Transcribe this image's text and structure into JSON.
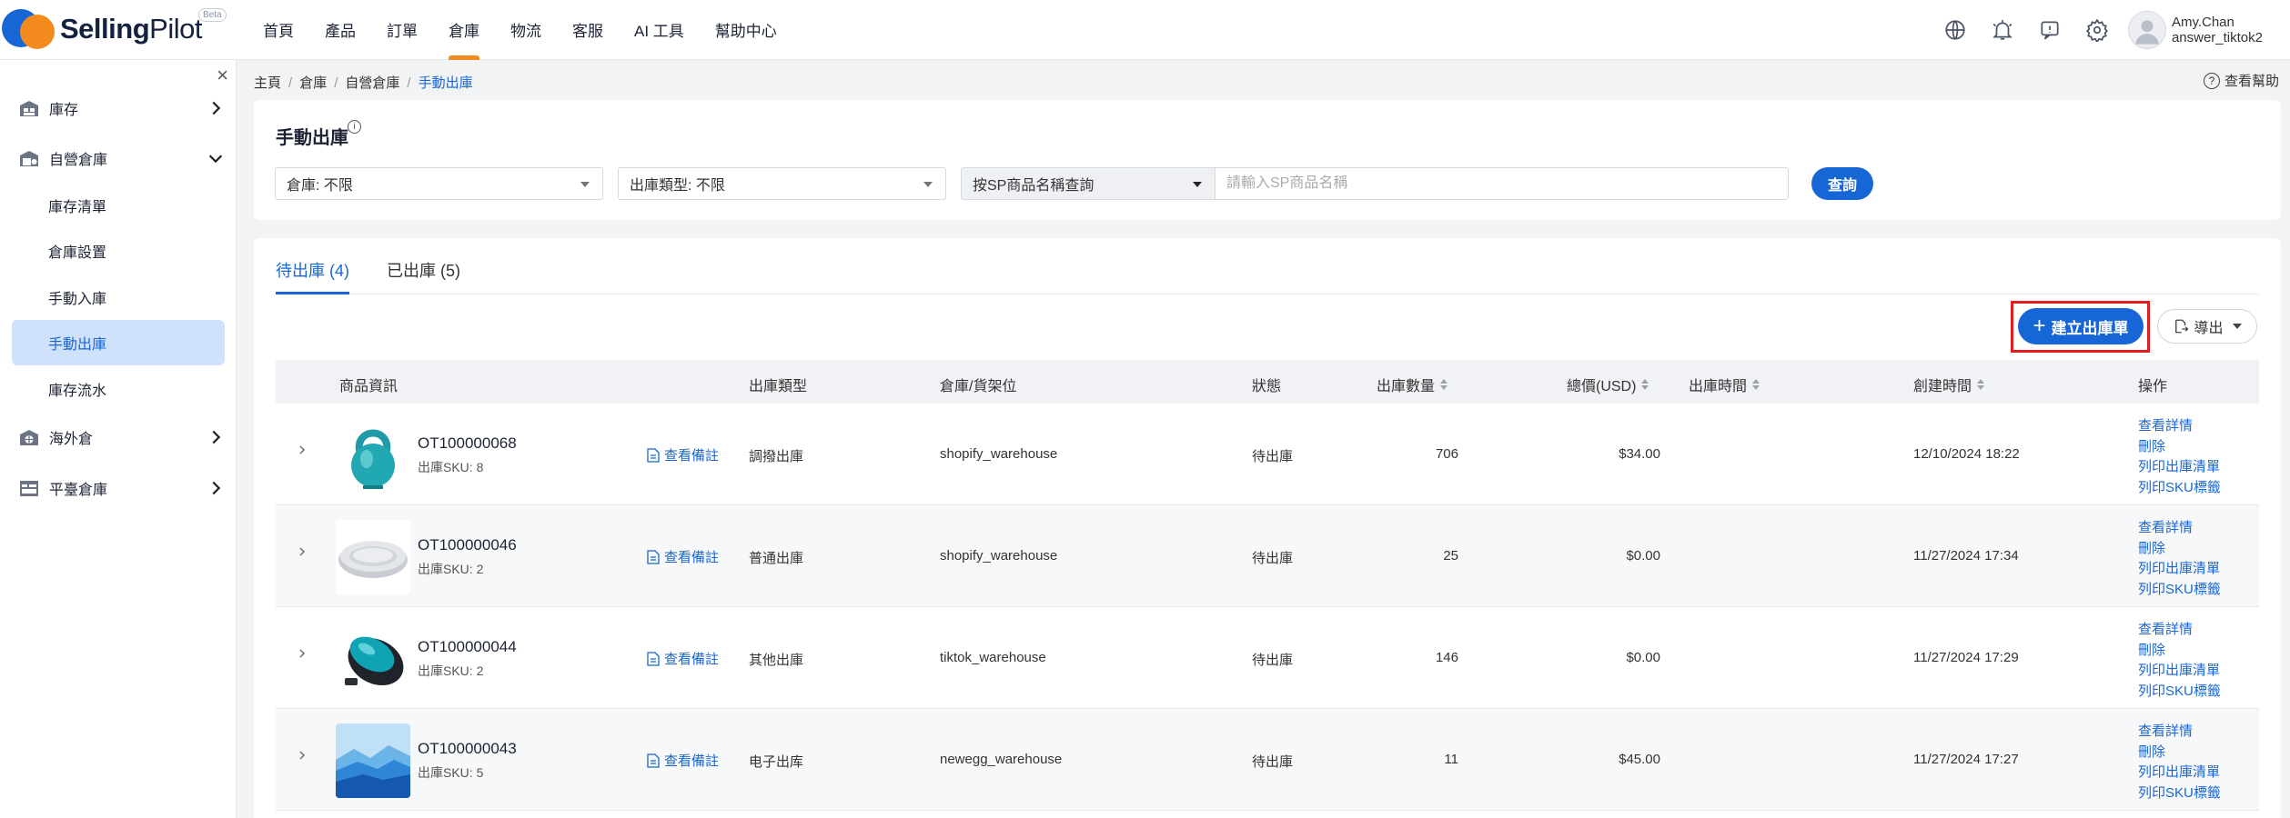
{
  "brand": {
    "name_bold": "Selling",
    "name_light": "Pilot",
    "badge": "Beta"
  },
  "nav": [
    "首頁",
    "產品",
    "訂單",
    "倉庫",
    "物流",
    "客服",
    "AI 工具",
    "幫助中心"
  ],
  "nav_active": 3,
  "user": {
    "name": "Amy.Chan",
    "account": "answer_tiktok2"
  },
  "sidebar": {
    "groups": [
      {
        "label": "庫存",
        "icon": "warehouse-icon"
      },
      {
        "label": "自營倉庫",
        "icon": "own-warehouse-icon"
      },
      {
        "label": "海外倉",
        "icon": "overseas-warehouse-icon"
      },
      {
        "label": "平臺倉庫",
        "icon": "platform-warehouse-icon"
      }
    ],
    "subitems": [
      "庫存清單",
      "倉庫設置",
      "手動入庫",
      "手動出庫",
      "庫存流水"
    ],
    "active_sub": 3
  },
  "breadcrumb": [
    "主頁",
    "倉庫",
    "自營倉庫",
    "手動出庫"
  ],
  "help": "查看幫助",
  "page_title": "手動出庫",
  "filters": {
    "warehouse": "倉庫: 不限",
    "outbound_type": "出庫類型: 不限",
    "search_type": "按SP商品名稱查詢",
    "search_placeholder": "請輸入SP商品名稱",
    "query_button": "查詢"
  },
  "tabs": [
    {
      "label": "待出庫 (4)",
      "active": true
    },
    {
      "label": "已出庫 (5)",
      "active": false
    }
  ],
  "actions": {
    "create": "建立出庫單",
    "export": "導出"
  },
  "columns": [
    "商品資訊",
    "出庫類型",
    "倉庫/貨架位",
    "狀態",
    "出庫數量",
    "總價(USD)",
    "出庫時間",
    "創建時間",
    "操作"
  ],
  "rows": [
    {
      "order": "OT100000068",
      "sku": "出庫SKU: 8",
      "note": "查看備註",
      "type": "調撥出庫",
      "warehouse": "shopify_warehouse",
      "status": "待出庫",
      "qty": "706",
      "total": "$34.00",
      "out_time": "",
      "created": "12/10/2024 18:22",
      "thumb": "kettlebell"
    },
    {
      "order": "OT100000046",
      "sku": "出庫SKU: 2",
      "note": "查看備註",
      "type": "普通出庫",
      "warehouse": "shopify_warehouse",
      "status": "待出庫",
      "qty": "25",
      "total": "$0.00",
      "out_time": "",
      "created": "11/27/2024 17:34",
      "thumb": "tray"
    },
    {
      "order": "OT100000044",
      "sku": "出庫SKU: 2",
      "note": "查看備註",
      "type": "其他出庫",
      "warehouse": "tiktok_warehouse",
      "status": "待出庫",
      "qty": "146",
      "total": "$0.00",
      "out_time": "",
      "created": "11/27/2024 17:29",
      "thumb": "mouse"
    },
    {
      "order": "OT100000043",
      "sku": "出庫SKU: 5",
      "note": "查看備註",
      "type": "电子出库",
      "warehouse": "newegg_warehouse",
      "status": "待出庫",
      "qty": "11",
      "total": "$45.00",
      "out_time": "",
      "created": "11/27/2024 17:27",
      "thumb": "mountains"
    }
  ],
  "row_ops": [
    "查看詳情",
    "刪除",
    "列印出庫清單",
    "列印SKU標籤"
  ],
  "colors": {
    "primary": "#1766d6",
    "accent": "#f38b1f",
    "highlight": "#e01c1c"
  }
}
